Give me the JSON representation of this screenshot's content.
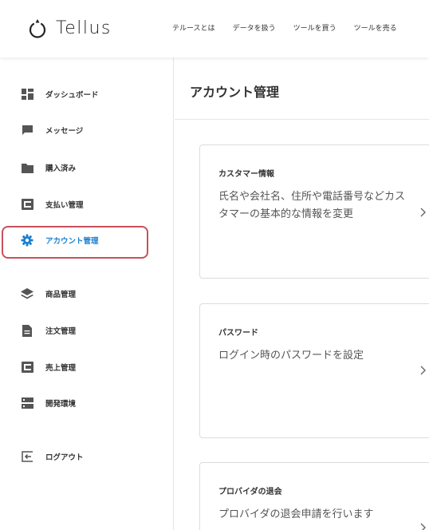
{
  "brand": {
    "name": "Tellus"
  },
  "topnav": [
    {
      "label": "テルースとは"
    },
    {
      "label": "データを扱う"
    },
    {
      "label": "ツールを買う"
    },
    {
      "label": "ツールを売る"
    }
  ],
  "sidebar": {
    "items": [
      {
        "label": "ダッシュボード",
        "icon": "dashboard-icon"
      },
      {
        "label": "メッセージ",
        "icon": "message-icon"
      },
      {
        "label": "購入済み",
        "icon": "folder-icon"
      },
      {
        "label": "支払い管理",
        "icon": "payment-icon"
      },
      {
        "label": "アカウント管理",
        "icon": "gear-icon",
        "active": true
      },
      {
        "label": "商品管理",
        "icon": "layers-icon"
      },
      {
        "label": "注文管理",
        "icon": "document-icon"
      },
      {
        "label": "売上管理",
        "icon": "sales-icon"
      },
      {
        "label": "開発環境",
        "icon": "server-icon"
      },
      {
        "label": "ログアウト",
        "icon": "logout-icon"
      }
    ]
  },
  "main": {
    "title": "アカウント管理",
    "cards": [
      {
        "title": "カスタマー情報",
        "description": "氏名や会社名、住所や電話番号などカスタマーの基本的な情報を変更"
      },
      {
        "title": "パスワード",
        "description": "ログイン時のパスワードを設定"
      },
      {
        "title": "プロバイダの退会",
        "description": "プロバイダの退会申請を行います"
      }
    ]
  },
  "colors": {
    "accent": "#1a7fd0",
    "highlight": "#c8505c",
    "icon": "#555555"
  }
}
